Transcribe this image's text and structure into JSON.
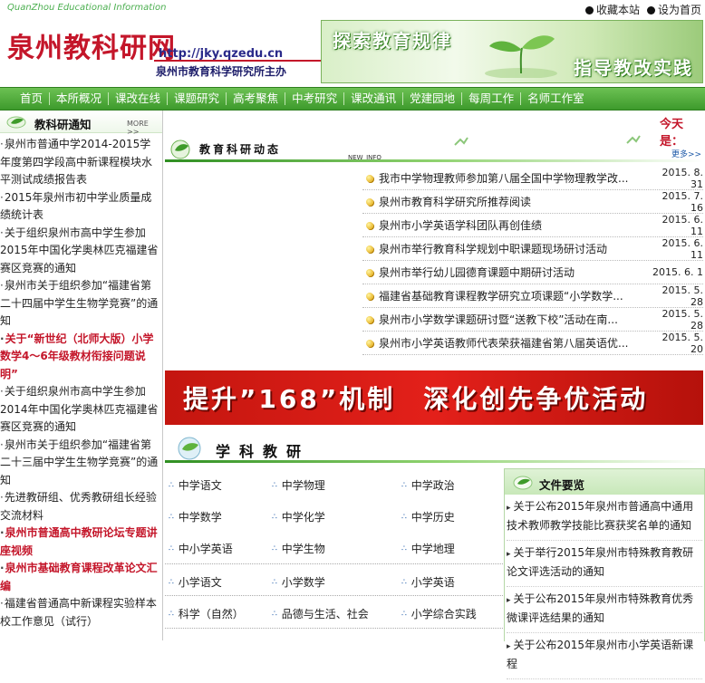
{
  "topbar": {
    "site_en": "QuanZhou Educational Information",
    "bookmark_label": "收藏本站",
    "homepage_label": "设为首页"
  },
  "header": {
    "logo_text": "泉州教科研网",
    "url": "http://jky.qzedu.cn",
    "sponsor": "泉州市教育科学研究所主办",
    "banner_left": "探索教育规律",
    "banner_right": "指导教改实践"
  },
  "nav": {
    "items": [
      "首页",
      "本所概况",
      "课改在线",
      "课题研究",
      "高考聚焦",
      "中考研究",
      "课改通讯",
      "党建园地",
      "每周工作",
      "名师工作室"
    ]
  },
  "left": {
    "title": "教科研通知",
    "more": "MORE >>",
    "items": [
      {
        "text": "泉州市普通中学2014-2015学年度第四学段高中新课程模块水平测试成绩报告表",
        "red": false
      },
      {
        "text": "2015年泉州市初中学业质量成绩统计表",
        "red": false
      },
      {
        "text": "关于组织泉州市高中学生参加2015年中国化学奥林匹克福建省赛区竞赛的通知",
        "red": false
      },
      {
        "text": "泉州市关于组织参加“福建省第二十四届中学生生物学竞赛”的通知",
        "red": false
      },
      {
        "text": "关于“新世纪（北师大版）小学数学4～6年级教材衔接问题说明”",
        "red": true
      },
      {
        "text": "关于组织泉州市高中学生参加2014年中国化学奥林匹克福建省赛区竞赛的通知",
        "red": false
      },
      {
        "text": "泉州市关于组织参加“福建省第二十三届中学生生物学竞赛”的通知",
        "red": false
      },
      {
        "text": "先进教研组、优秀教研组长经验交流材料",
        "red": false
      },
      {
        "text": "泉州市普通高中教研论坛专题讲座视频",
        "red": true
      },
      {
        "text": "泉州市基础教育课程改革论文汇编",
        "red": true
      },
      {
        "text": "福建省普通高中新课程实验样本校工作意见（试行）",
        "red": false
      }
    ]
  },
  "marquee": {
    "today": "今天是："
  },
  "dynamics": {
    "title": "教育科研动态",
    "new_info": "NEW_INFO",
    "more": "更多>>",
    "items": [
      {
        "title": "我市中学物理教师参加第八届全国中学物理教学改...",
        "date": "2015. 8. 31"
      },
      {
        "title": "泉州市教育科学研究所推荐阅读",
        "date": "2015. 7. 16"
      },
      {
        "title": "泉州市小学英语学科团队再创佳绩",
        "date": "2015. 6. 11"
      },
      {
        "title": "泉州市举行教育科学规划中职课题现场研讨活动",
        "date": "2015. 6. 11"
      },
      {
        "title": "泉州市举行幼儿园德育课题中期研讨活动",
        "date": "2015. 6. 1"
      },
      {
        "title": "福建省基础教育课程教学研究立项课题“小学数学...",
        "date": "2015. 5. 28"
      },
      {
        "title": "泉州市小学数学课题研讨暨“送教下校”活动在南...",
        "date": "2015. 5. 28"
      },
      {
        "title": "泉州市小学英语教师代表荣获福建省第八届英语优...",
        "date": "2015. 5. 20"
      }
    ]
  },
  "red_banner": {
    "text": "提升”168”机制　深化创先争优活动"
  },
  "subjects": {
    "title": "学科教研",
    "rows": [
      [
        "中学语文",
        "中学物理",
        "中学政治"
      ],
      [
        "中学数学",
        "中学化学",
        "中学历史"
      ],
      [
        "中小学英语",
        "中学生物",
        "中学地理"
      ],
      [
        "小学语文",
        "小学数学",
        "小学英语"
      ],
      [
        "科学（自然）",
        "品德与生活、社会",
        "小学综合实践"
      ]
    ]
  },
  "docs": {
    "title": "文件要览",
    "items": [
      "关于公布2015年泉州市普通高中通用技术教师教学技能比赛获奖名单的通知",
      "关于举行2015年泉州市特殊教育教研论文评选活动的通知",
      "关于公布2015年泉州市特殊教育优秀微课评选结果的通知",
      "关于公布2015年泉州市小学英语新课程"
    ]
  },
  "colors": {
    "brand_green": "#3d9a2c",
    "brand_red": "#c4162a"
  }
}
